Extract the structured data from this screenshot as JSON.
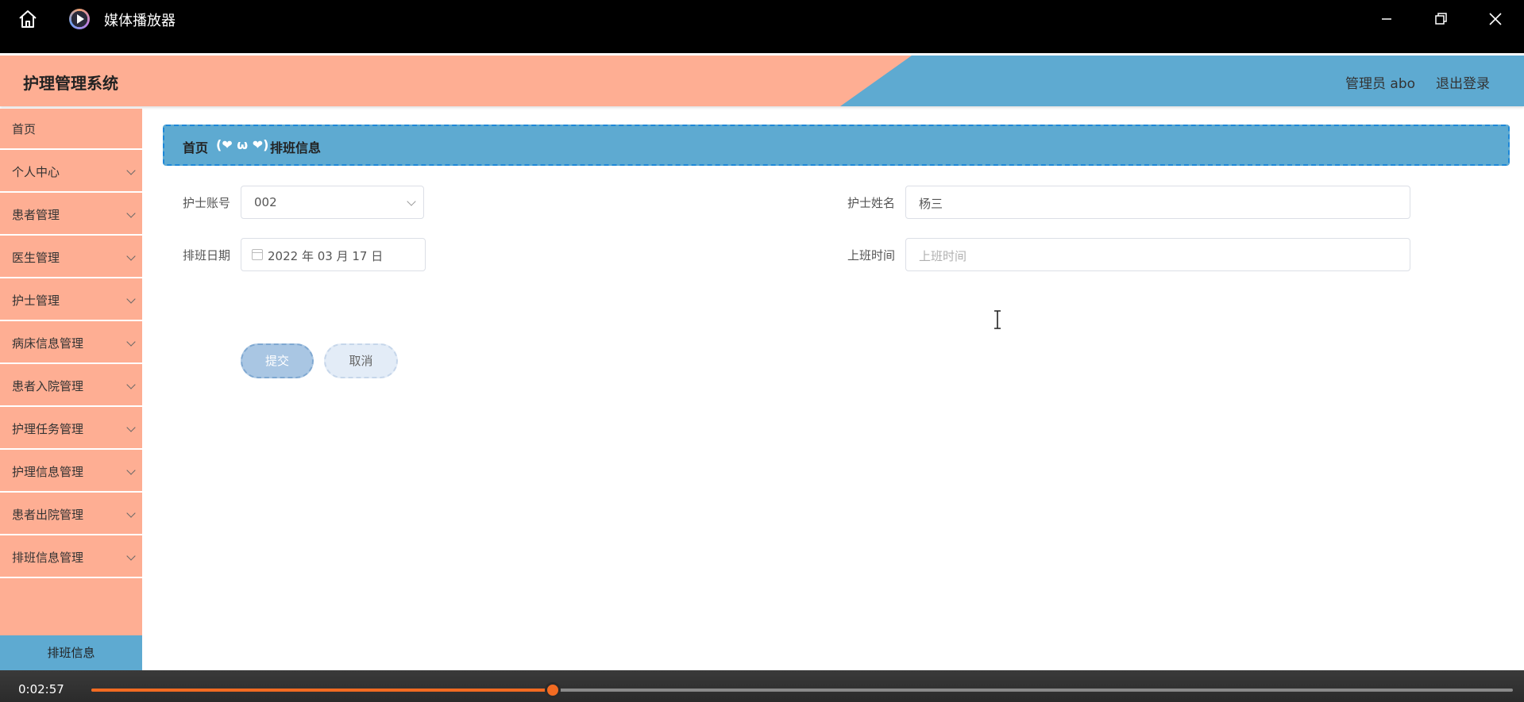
{
  "player": {
    "title": "媒体播放器",
    "current_time": "0:02:57",
    "progress": 0.3245,
    "accent_color": "#f26b22"
  },
  "app": {
    "title": "护理管理系统",
    "user_label": "管理员 abo",
    "logout_label": "退出登录",
    "colors": {
      "salmon": "#feae93",
      "blue": "#5eaad1"
    }
  },
  "sidebar": {
    "items": [
      {
        "label": "首页",
        "has_chevron": false
      },
      {
        "label": "个人中心",
        "has_chevron": true
      },
      {
        "label": "患者管理",
        "has_chevron": true
      },
      {
        "label": "医生管理",
        "has_chevron": true
      },
      {
        "label": "护士管理",
        "has_chevron": true
      },
      {
        "label": "病床信息管理",
        "has_chevron": true
      },
      {
        "label": "患者入院管理",
        "has_chevron": true
      },
      {
        "label": "护理任务管理",
        "has_chevron": true
      },
      {
        "label": "护理信息管理",
        "has_chevron": true
      },
      {
        "label": "患者出院管理",
        "has_chevron": true
      },
      {
        "label": "排班信息管理",
        "has_chevron": true
      }
    ],
    "sub_item": "排班信息"
  },
  "breadcrumb": {
    "home": "首页",
    "separator": "(❤ ω ❤)",
    "current": "排班信息"
  },
  "form": {
    "nurse_account_label": "护士账号",
    "nurse_account_value": "002",
    "nurse_name_label": "护士姓名",
    "nurse_name_value": "杨三",
    "schedule_date_label": "排班日期",
    "schedule_date_value": "2022 年 03 月 17 日",
    "shift_time_label": "上班时间",
    "shift_time_placeholder": "上班时间",
    "submit_label": "提交",
    "cancel_label": "取消"
  },
  "icons": {
    "home": "home-icon",
    "app": "media-player-icon",
    "minimize": "minimize-icon",
    "maximize": "restore-icon",
    "close": "close-icon",
    "select": "chevron-down-icon",
    "date": "calendar-icon",
    "cursor": "text-cursor-icon"
  }
}
